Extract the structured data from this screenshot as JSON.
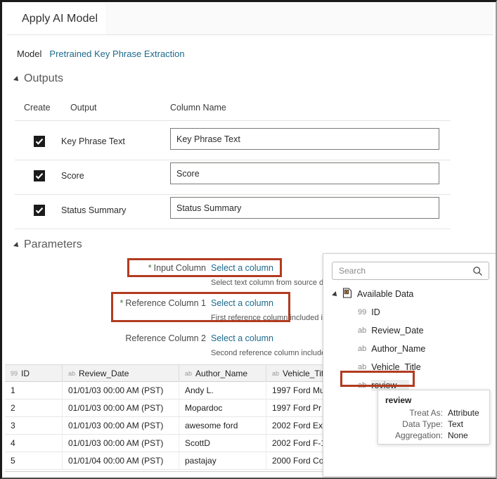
{
  "window": {
    "tab_label": "Apply AI Model"
  },
  "model": {
    "label": "Model",
    "value": "Pretrained Key Phrase Extraction"
  },
  "outputs": {
    "section_title": "Outputs",
    "headers": {
      "create": "Create",
      "output": "Output",
      "column_name": "Column Name"
    },
    "rows": [
      {
        "checked": true,
        "output": "Key Phrase Text",
        "column_name": "Key Phrase Text"
      },
      {
        "checked": true,
        "output": "Score",
        "column_name": "Score"
      },
      {
        "checked": true,
        "output": "Status Summary",
        "column_name": "Status Summary"
      }
    ]
  },
  "parameters": {
    "section_title": "Parameters",
    "rows": [
      {
        "required": true,
        "star": "*",
        "label": "Input Column",
        "link": "Select a column",
        "hint": "Select text column from source da",
        "highlighted": true
      },
      {
        "required": true,
        "star": "*",
        "label": "Reference Column 1",
        "link": "Select a column",
        "hint": "First reference column included in",
        "highlighted": true
      },
      {
        "required": false,
        "star": "",
        "label": "Reference Column 2",
        "link": "Select a column",
        "hint": "Second reference column included",
        "highlighted": false
      }
    ]
  },
  "dropdown": {
    "search": {
      "placeholder": "Search",
      "value": "",
      "icon": "search-icon"
    },
    "tree_root": {
      "label": "Available Data",
      "icon": "data-source-icon"
    },
    "items": [
      {
        "type_code": "99",
        "label": "ID",
        "selected": false
      },
      {
        "type_code": "ab",
        "label": "Review_Date",
        "selected": false
      },
      {
        "type_code": "ab",
        "label": "Author_Name",
        "selected": false
      },
      {
        "type_code": "ab",
        "label": "Vehicle_Title",
        "selected": false
      },
      {
        "type_code": "ab",
        "label": "review",
        "selected": true
      }
    ]
  },
  "tooltip": {
    "title": "review",
    "rows": [
      {
        "key": "Treat As:",
        "value": "Attribute"
      },
      {
        "key": "Data Type:",
        "value": "Text"
      },
      {
        "key": "Aggregation:",
        "value": "None"
      }
    ]
  },
  "grid": {
    "columns": [
      {
        "type_code": "99",
        "name": "ID"
      },
      {
        "type_code": "ab",
        "name": "Review_Date"
      },
      {
        "type_code": "ab",
        "name": "Author_Name"
      },
      {
        "type_code": "ab",
        "name": "Vehicle_Tit"
      }
    ],
    "rows": [
      {
        "id": "1",
        "review_date": "01/01/03 00:00 AM (PST)",
        "author_name": "Andy L.",
        "vehicle_title": "1997 Ford Mu"
      },
      {
        "id": "2",
        "review_date": "01/01/03 00:00 AM (PST)",
        "author_name": "Mopardoc",
        "vehicle_title": "1997 Ford Pr"
      },
      {
        "id": "3",
        "review_date": "01/01/03 00:00 AM (PST)",
        "author_name": "awesome ford",
        "vehicle_title": "2002 Ford Ex"
      },
      {
        "id": "4",
        "review_date": "01/01/03 00:00 AM (PST)",
        "author_name": "ScottD",
        "vehicle_title": "2002 Ford F-1"
      },
      {
        "id": "5",
        "review_date": "01/01/04 00:00 AM (PST)",
        "author_name": "pastajay",
        "vehicle_title": "2000 Ford Co"
      }
    ]
  },
  "colors": {
    "link": "#1d6a8c",
    "highlight": "#b23b20",
    "required_star": "#3f7a3f",
    "section_title": "#595959"
  }
}
